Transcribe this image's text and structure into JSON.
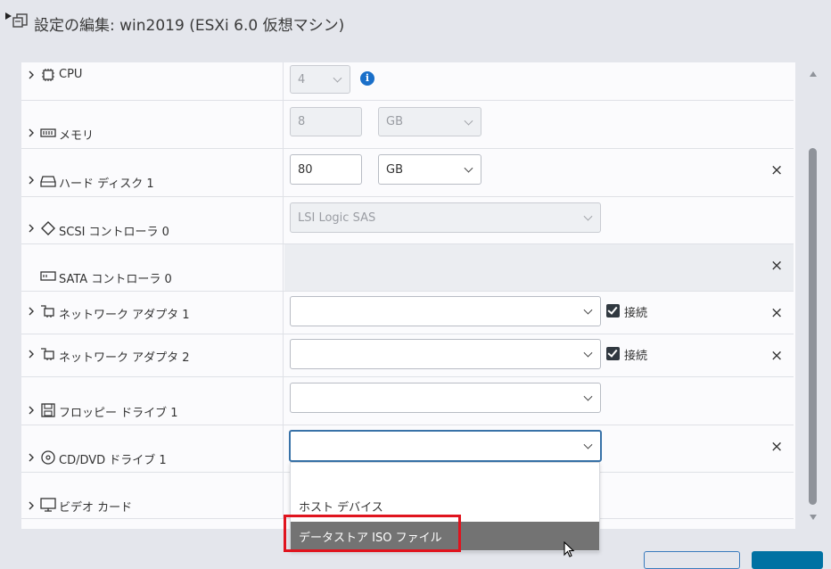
{
  "dialog": {
    "title": "設定の編集: win2019 (ESXi 6.0 仮想マシン)",
    "title_icon": "edit-settings-icon"
  },
  "rows": {
    "cpu": {
      "label": "CPU",
      "icon": "cpu-icon",
      "value": "4"
    },
    "memory": {
      "label": "メモリ",
      "icon": "memory-icon",
      "value": "8",
      "unit": "GB"
    },
    "hard_disk": {
      "label": "ハード ディスク 1",
      "icon": "hard-disk-icon",
      "value": "80",
      "unit": "GB"
    },
    "scsi": {
      "label": "SCSI コントローラ 0",
      "icon": "scsi-icon",
      "value": "LSI Logic SAS"
    },
    "sata": {
      "label": "SATA コントローラ 0",
      "icon": "sata-icon"
    },
    "net1": {
      "label": "ネットワーク アダプタ 1",
      "icon": "network-adapter-icon",
      "value": "",
      "connect_label": "接続",
      "connected": true
    },
    "net2": {
      "label": "ネットワーク アダプタ 2",
      "icon": "network-adapter-icon",
      "value": "",
      "connect_label": "接続",
      "connected": true
    },
    "floppy": {
      "label": "フロッピー ドライブ 1",
      "icon": "floppy-icon",
      "value": ""
    },
    "cddvd": {
      "label": "CD/DVD ドライブ 1",
      "icon": "cd-dvd-icon",
      "value": ""
    },
    "video": {
      "label": "ビデオ カード",
      "icon": "monitor-icon"
    }
  },
  "dropdown": {
    "options": [
      "ホスト デバイス",
      "データストア ISO ファイル"
    ],
    "highlighted": "データストア ISO ファイル"
  },
  "colors": {
    "highlight_border": "#e0141e",
    "selected_option_bg": "#737373",
    "info": "#1a6fc9",
    "focus_border": "#3872a8"
  }
}
